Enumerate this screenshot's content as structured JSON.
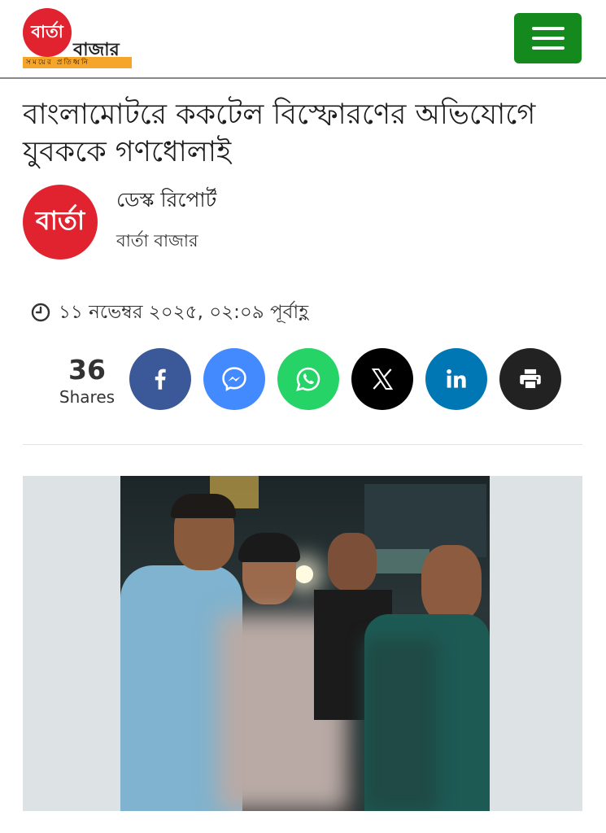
{
  "header": {
    "logo_circle": "বার্তা",
    "logo_word": "বাজার",
    "logo_tagline": "সময়ের প্রতিধ্বনি"
  },
  "article": {
    "headline": "বাংলামোটরে ককটেল বিস্ফোরণের অভিযোগে যুবককে গণধোলাই",
    "author_avatar": "বার্তা",
    "author_name": "ডেস্ক রিপোর্ট",
    "publisher": "বার্তা বাজার",
    "date": "১১ নভেম্বর ২০২৫, ০২:০৯ পূর্বাহ্ণ"
  },
  "share": {
    "count": "36",
    "label": "Shares",
    "buttons": [
      {
        "name": "facebook",
        "icon": "facebook-icon",
        "color": "#3b5998"
      },
      {
        "name": "messenger",
        "icon": "messenger-icon",
        "color": "#448aff"
      },
      {
        "name": "whatsapp",
        "icon": "whatsapp-icon",
        "color": "#25d366"
      },
      {
        "name": "x",
        "icon": "x-icon",
        "color": "#000000"
      },
      {
        "name": "linkedin",
        "icon": "linkedin-icon",
        "color": "#0077b5"
      },
      {
        "name": "print",
        "icon": "print-icon",
        "color": "#222222"
      }
    ]
  },
  "colors": {
    "brand_red": "#e0232f",
    "menu_green": "#148a1e",
    "tagline_orange": "#f4a52a"
  }
}
